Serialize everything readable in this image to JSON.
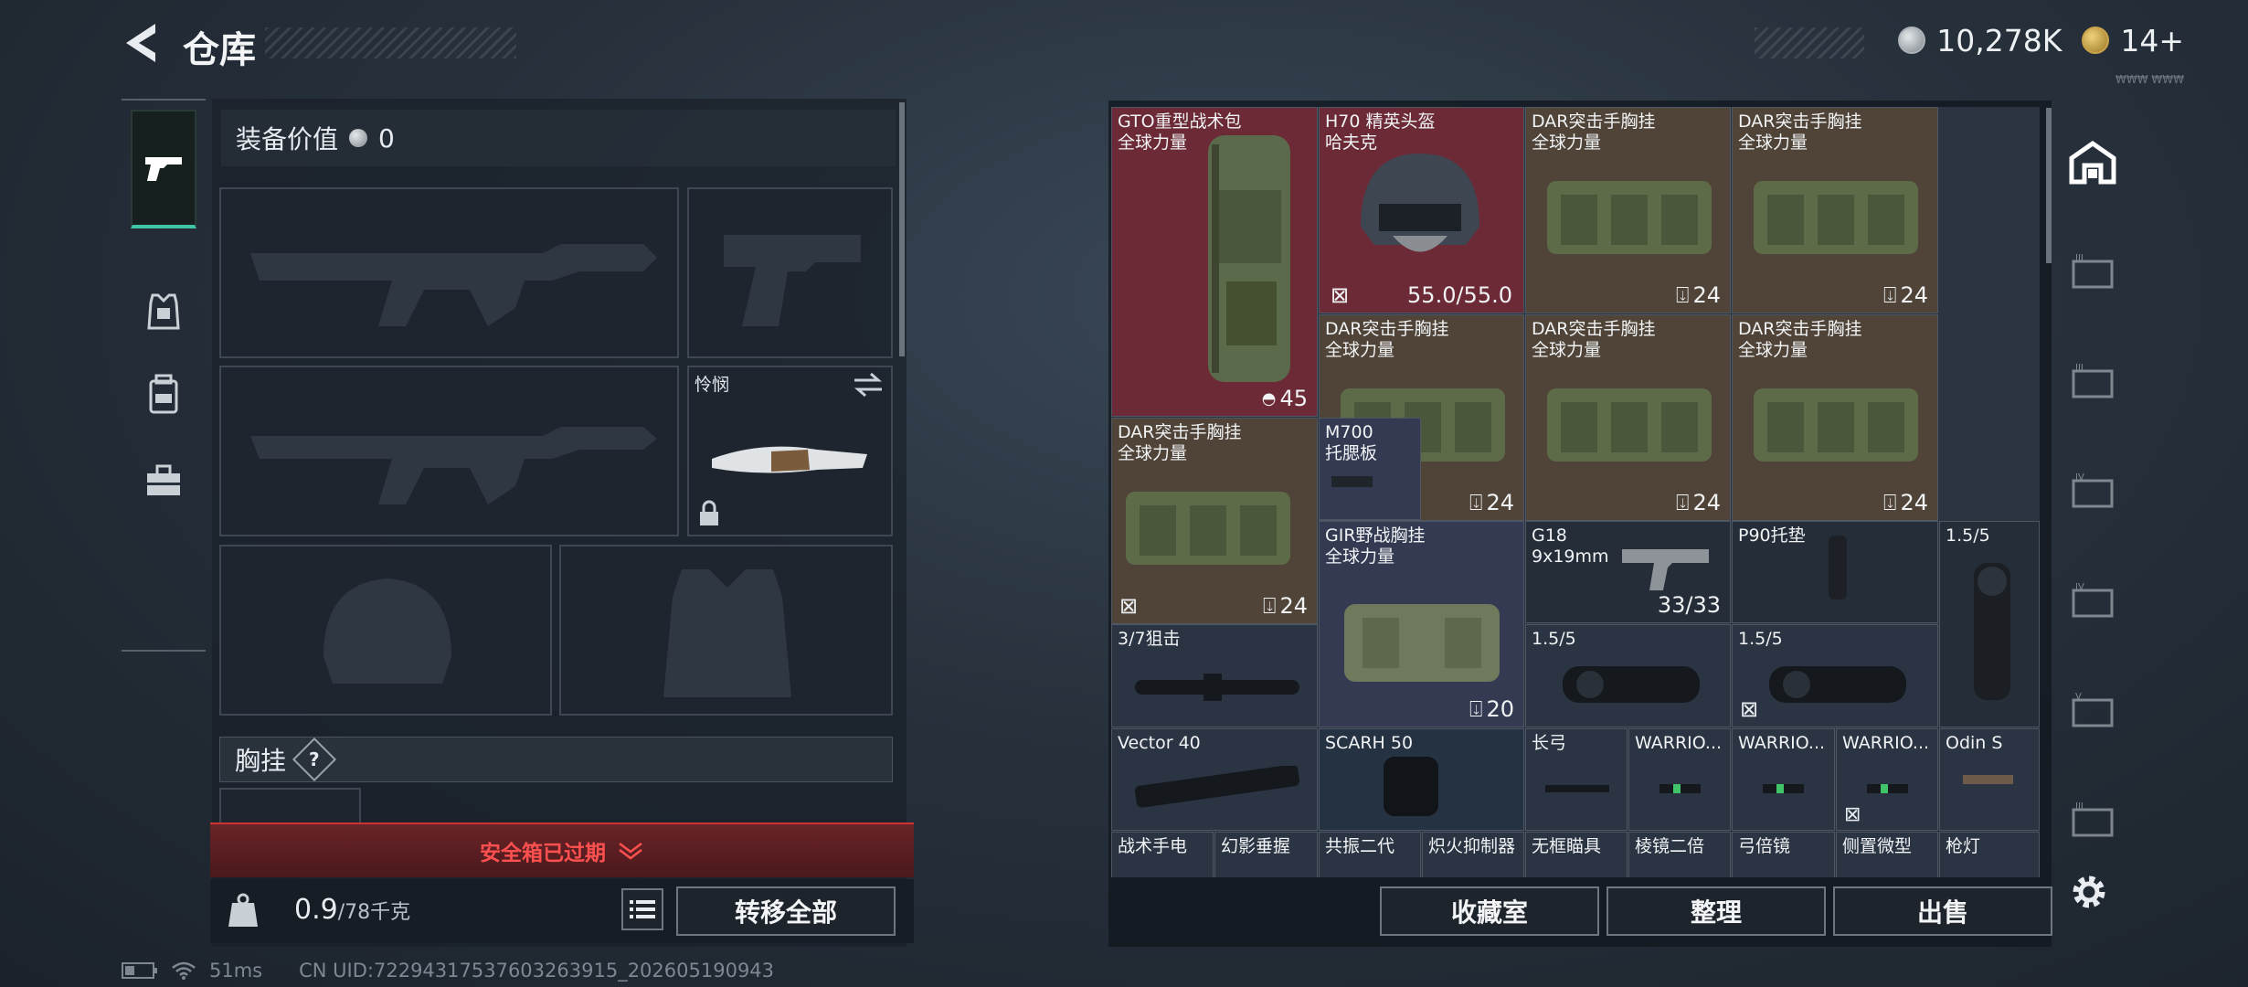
{
  "topbar": {
    "title": "仓库"
  },
  "currency": {
    "coins": "10,278K",
    "tickets": "14+",
    "mini_text": "₩₩₩ ₩₩₩"
  },
  "equip": {
    "label": "装备价值",
    "value": "0"
  },
  "melee": {
    "name": "怜悯"
  },
  "chest": {
    "label": "胸挂",
    "q": "?"
  },
  "safe_box": {
    "text": "安全箱已过期"
  },
  "weight": {
    "current": "0.9",
    "max": "/78千克"
  },
  "buttons": {
    "transfer_all": "转移全部",
    "vault": "收藏室",
    "sort": "整理",
    "sell": "出售"
  },
  "status": {
    "ping": "51ms",
    "uid": "CN UID:722943175376032639‍15_202605190943"
  },
  "stash": [
    {
      "name": "GTO重型战术包\n全球力量",
      "count": "45",
      "count_icon": "bag"
    },
    {
      "name": "H70 精英头盔\n哈夫克",
      "durability": "55.0/55.0"
    },
    {
      "name": "DAR突击手胸挂\n全球力量",
      "count": "24"
    },
    {
      "name": "DAR突击手胸挂\n全球力量",
      "count": "24"
    },
    {
      "name": "DAR突击手胸挂\n全球力量",
      "count": "24"
    },
    {
      "name": "DAR突击手胸挂\n全球力量",
      "count": "24"
    },
    {
      "name": "DAR突击手胸挂\n全球力量",
      "count": "24"
    },
    {
      "name": "DAR突击手胸挂\n全球力量",
      "count": "24"
    },
    {
      "name": "M700\n托腮板"
    },
    {
      "name": "GIR野战胸挂\n全球力量",
      "count": "20"
    },
    {
      "name": "G18\n9x19mm",
      "ammo": "33/33"
    },
    {
      "name": "P90托垫"
    },
    {
      "name": "1.5/5"
    },
    {
      "name": "3/7狙击"
    },
    {
      "name": "1.5/5"
    },
    {
      "name": "1.5/5"
    },
    {
      "name": "Vector 40"
    },
    {
      "name": "SCARH 50"
    },
    {
      "name": "长弓"
    },
    {
      "name": "WARRIO..."
    },
    {
      "name": "WARRIO..."
    },
    {
      "name": "WARRIO..."
    },
    {
      "name": "Odin S"
    },
    {
      "name": "战术手电"
    },
    {
      "name": "幻影垂握"
    },
    {
      "name": "共振二代"
    },
    {
      "name": "炽火抑制器"
    },
    {
      "name": "无框瞄具"
    },
    {
      "name": "棱镜二倍"
    },
    {
      "name": "弓倍镜"
    },
    {
      "name": "侧置微型"
    },
    {
      "name": "枪灯"
    }
  ],
  "colors": {
    "accent_green": "#3fc4a5",
    "alert_red": "#ff5050",
    "rare_red": "#6b2a36",
    "rare_brown": "#4f4437",
    "rare_blue": "#333a52"
  },
  "icons": [
    "back-arrow-icon",
    "silver-coin-icon",
    "gold-ticket-icon",
    "pistol-icon",
    "vest-icon",
    "backpack-icon",
    "toolbox-icon",
    "lock-icon",
    "swap-icon",
    "list-icon",
    "weight-icon",
    "battery-icon",
    "wifi-icon",
    "stash-home-icon",
    "gear-icon"
  ]
}
